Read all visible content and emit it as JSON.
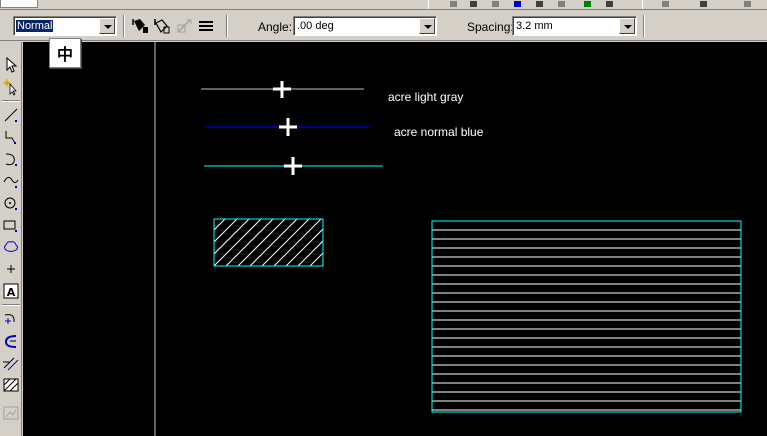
{
  "toolbar": {
    "style_value": "Normal",
    "angle_label": "Angle:",
    "angle_value": ".00 deg",
    "spacing_label": "Spacing:",
    "spacing_value": "3.2 mm"
  },
  "floating_button": {
    "glyph": "中"
  },
  "canvas": {
    "background": "#000000",
    "labels": {
      "light_gray": "acre light gray",
      "normal_blue": "acre normal blue"
    },
    "line_colors": {
      "light_gray": "#c0c0c0",
      "normal_blue": "#0000ff",
      "cyan": "#00ffff"
    }
  },
  "tools": [
    "select-arrow-icon",
    "select-magic-icon",
    "line-icon",
    "polyline-icon",
    "arc-icon",
    "curve-icon",
    "circle-icon",
    "rectangle-icon",
    "cloud-icon",
    "point-icon",
    "text-icon",
    "tangent-arc-icon",
    "fillet-icon",
    "parallel-lines-icon",
    "hatch-icon",
    "image-icon"
  ]
}
